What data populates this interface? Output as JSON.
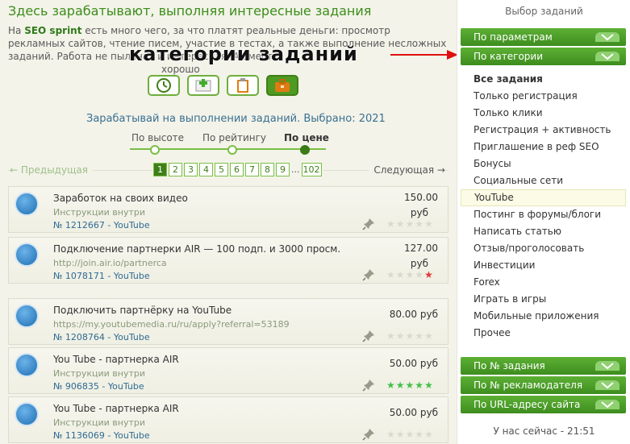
{
  "page_title": "Здесь зарабатывают, выполняя интересные задания",
  "intro": {
    "before": "На ",
    "brand": "SEO sprint",
    "after": " есть много чего, за что платят реальные деньги: просмотр рекламных сайтов, чтение писем, участие в тестах, а также выполнение несложных заданий. Работа не пыльная и интересная. А вместе",
    "tail": "хорошо"
  },
  "overlay_caption": "категории заданий",
  "icons": [
    "clock-icon",
    "add-icon",
    "clipboard-icon",
    "briefcase-icon"
  ],
  "earn_title": "Зарабатывай на выполнении заданий. Выбрано: 2021",
  "sort": {
    "by_height": "По высоте",
    "by_rating": "По рейтингу",
    "by_price": "По цене"
  },
  "pager": {
    "prev": "← Предыдущая",
    "next": "Следующая →",
    "pages": [
      "1",
      "2",
      "3",
      "4",
      "5",
      "6",
      "7",
      "8",
      "9"
    ],
    "ellipsis": "...",
    "last": "102"
  },
  "tasks": [
    {
      "title": "Заработок на своих видео",
      "sub": "Инструкции внутри",
      "id": "№ 1212667 - YouTube",
      "price": "150.00",
      "unit": "руб",
      "stars": [
        "off",
        "off",
        "off",
        "off",
        "off"
      ]
    },
    {
      "title": "Подключение партнерки AIR — 100 подп. и 3000 просм.",
      "sub": "http://join.air.io/partnerca",
      "id": "№ 1078171 - YouTube",
      "price": "127.00",
      "unit": "руб",
      "stars": [
        "off",
        "off",
        "off",
        "off",
        "red"
      ]
    },
    {
      "title": "Подключить партнёрку на YouTube",
      "sub": "https://my.youtubemedia.ru/ru/apply?referral=53189",
      "id": "№ 1208764 - YouTube",
      "price": "80.00 руб",
      "unit": "",
      "stars": [
        "off",
        "off",
        "off",
        "off",
        "off"
      ]
    },
    {
      "title": "You Tube - партнерка AIR",
      "sub": "Инструкции внутри",
      "id": "№ 906835 - YouTube",
      "price": "50.00 руб",
      "unit": "",
      "stars": [
        "on",
        "on",
        "on",
        "on",
        "on"
      ]
    },
    {
      "title": "You Tube - партнерка AIR",
      "sub": "Инструкции внутри",
      "id": "№ 1136069 - YouTube",
      "price": "50.00 руб",
      "unit": "",
      "stars": [
        "off",
        "off",
        "off",
        "off",
        "off"
      ]
    }
  ],
  "right_panel": {
    "title": "Выбор заданий",
    "by_params": "По параметрам",
    "by_category": "По категории",
    "categories": [
      "Все задания",
      "Только регистрация",
      "Только клики",
      "Регистрация + активность",
      "Приглашение в реф SEO",
      "Бонусы",
      "Социальные сети",
      "YouTube",
      "Постинг в форумы/блоги",
      "Написать статью",
      "Отзыв/проголосовать",
      "Инвестиции",
      "Forex",
      "Играть в игры",
      "Мобильные приложения",
      "Прочее"
    ],
    "by_task_no": "По № задания",
    "by_advertiser_no": "По № рекламодателя",
    "by_url": "По URL-адресу сайта",
    "clock": "У нас сейчас - 21:51"
  },
  "colors": {
    "accent": "#3f7f18",
    "link": "#2f6a93",
    "arrow": "#e01010"
  }
}
